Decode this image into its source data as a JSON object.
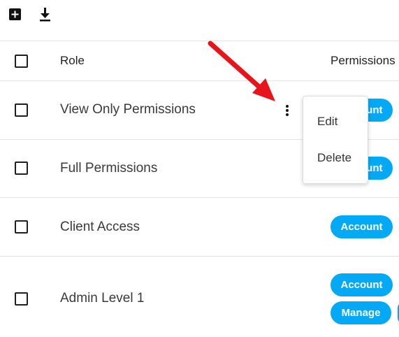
{
  "toolbar": {
    "add_icon": "add-box-icon",
    "download_icon": "download-icon"
  },
  "table": {
    "columns": [
      "Role",
      "Permissions"
    ],
    "rows": [
      {
        "role": "View Only Permissions",
        "permissions": [
          "Account"
        ]
      },
      {
        "role": "Full Permissions",
        "permissions": [
          "Account"
        ]
      },
      {
        "role": "Client Access",
        "permissions": [
          "Account"
        ]
      },
      {
        "role": "Admin Level 1",
        "permissions": [
          "Account",
          "Manage"
        ]
      }
    ]
  },
  "context_menu": {
    "items": [
      "Edit",
      "Delete"
    ]
  },
  "colors": {
    "pill": "#03a9f4",
    "arrow": "#e8141b"
  }
}
